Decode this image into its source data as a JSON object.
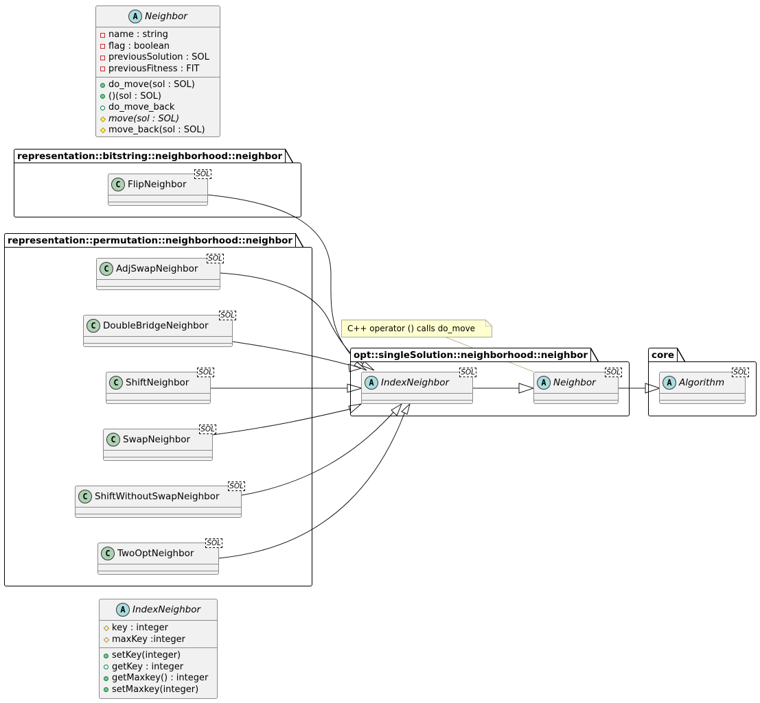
{
  "diagram": {
    "type": "uml-class-diagram",
    "template_param": "SOL",
    "legend_classes": [
      {
        "name": "Neighbor",
        "stereotype": "abstract",
        "badge": "A",
        "attributes": [
          {
            "visibility": "private",
            "text": "name : string"
          },
          {
            "visibility": "private",
            "text": "flag : boolean"
          },
          {
            "visibility": "private",
            "text": "previousSolution : SOL"
          },
          {
            "visibility": "private",
            "text": "previousFitness : FIT"
          }
        ],
        "methods": [
          {
            "visibility": "public",
            "text": "do_move(sol : SOL)"
          },
          {
            "visibility": "public",
            "text": "()(sol : SOL)"
          },
          {
            "visibility": "public-open",
            "text": "do_move_back"
          },
          {
            "visibility": "protected-filled",
            "text": "move(sol : SOL)",
            "italic": true
          },
          {
            "visibility": "protected-filled",
            "text": "move_back(sol : SOL)"
          }
        ]
      },
      {
        "name": "IndexNeighbor",
        "stereotype": "abstract",
        "badge": "A",
        "attributes": [
          {
            "visibility": "protected",
            "text": "key : integer"
          },
          {
            "visibility": "protected",
            "text": "maxKey :integer"
          }
        ],
        "methods": [
          {
            "visibility": "public",
            "text": "setKey(integer)"
          },
          {
            "visibility": "public-open",
            "text": "getKey : integer"
          },
          {
            "visibility": "public",
            "text": "getMaxkey() : integer"
          },
          {
            "visibility": "public",
            "text": "setMaxkey(integer)"
          }
        ]
      }
    ],
    "packages": [
      {
        "id": "bitstring",
        "name": "representation::bitstring::neighborhood::neighbor"
      },
      {
        "id": "permutation",
        "name": "representation::permutation::neighborhood::neighbor"
      },
      {
        "id": "opt",
        "name": "opt::singleSolution::neighborhood::neighbor"
      },
      {
        "id": "core",
        "name": "core"
      }
    ],
    "classes": {
      "flip": {
        "name": "FlipNeighbor",
        "badge": "C",
        "tparam": "SOL"
      },
      "adjswap": {
        "name": "AdjSwapNeighbor",
        "badge": "C",
        "tparam": "SOL"
      },
      "doublebridge": {
        "name": "DoubleBridgeNeighbor",
        "badge": "C",
        "tparam": "SOL"
      },
      "shift": {
        "name": "ShiftNeighbor",
        "badge": "C",
        "tparam": "SOL"
      },
      "swap": {
        "name": "SwapNeighbor",
        "badge": "C",
        "tparam": "SOL"
      },
      "shiftwithoutswap": {
        "name": "ShiftWithoutSwapNeighbor",
        "badge": "C",
        "tparam": "SOL"
      },
      "twoopt": {
        "name": "TwoOptNeighbor",
        "badge": "C",
        "tparam": "SOL"
      },
      "indexneighbor": {
        "name": "IndexNeighbor",
        "badge": "A",
        "tparam": "SOL"
      },
      "neighbor": {
        "name": "Neighbor",
        "badge": "A",
        "tparam": "SOL"
      },
      "algorithm": {
        "name": "Algorithm",
        "badge": "A",
        "tparam": "SOL"
      }
    },
    "note": {
      "text": "C++ operator () calls do_move",
      "attached_to": "Neighbor"
    },
    "relations": [
      {
        "from": "FlipNeighbor",
        "to": "IndexNeighbor",
        "type": "generalization"
      },
      {
        "from": "AdjSwapNeighbor",
        "to": "IndexNeighbor",
        "type": "generalization"
      },
      {
        "from": "DoubleBridgeNeighbor",
        "to": "IndexNeighbor",
        "type": "generalization"
      },
      {
        "from": "ShiftNeighbor",
        "to": "IndexNeighbor",
        "type": "generalization"
      },
      {
        "from": "SwapNeighbor",
        "to": "IndexNeighbor",
        "type": "generalization"
      },
      {
        "from": "ShiftWithoutSwapNeighbor",
        "to": "IndexNeighbor",
        "type": "generalization"
      },
      {
        "from": "TwoOptNeighbor",
        "to": "IndexNeighbor",
        "type": "generalization"
      },
      {
        "from": "IndexNeighbor",
        "to": "Neighbor",
        "type": "generalization"
      },
      {
        "from": "Neighbor",
        "to": "Algorithm",
        "type": "generalization"
      }
    ]
  }
}
